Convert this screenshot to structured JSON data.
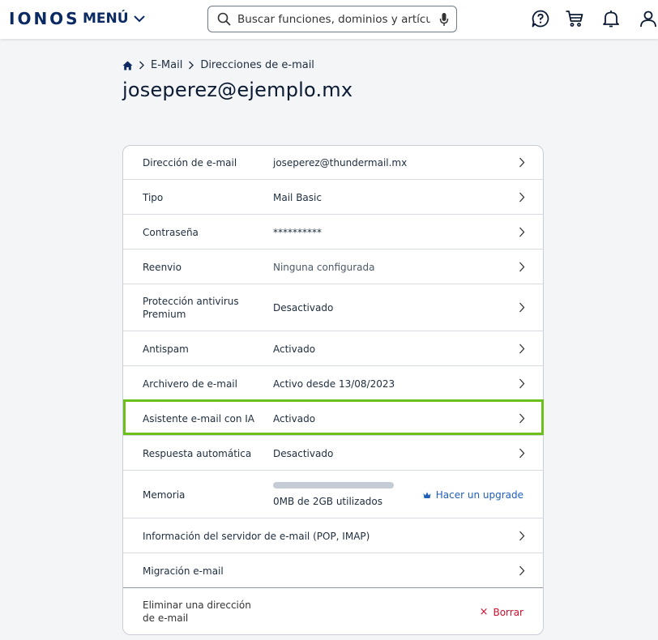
{
  "header": {
    "logo": "IONOS",
    "menu_label": "MENÚ",
    "search_placeholder": "Buscar funciones, dominios y artículos ..."
  },
  "breadcrumb": {
    "items": [
      "E-Mail",
      "Direcciones de e-mail"
    ]
  },
  "page_title": "joseperez@ejemplo.mx",
  "rows": [
    {
      "label": "Dirección de e-mail",
      "value": "joseperez@thundermail.mx"
    },
    {
      "label": "Tipo",
      "value": "Mail Basic"
    },
    {
      "label": "Contraseña",
      "value": "**********"
    },
    {
      "label": "Reenvio",
      "value": "Ninguna configurada"
    },
    {
      "label": "Protección antivirus Premium",
      "value": "Desactivado"
    },
    {
      "label": "Antispam",
      "value": "Activado"
    },
    {
      "label": "Archivero de e-mail",
      "value": "Activo desde 13/08/2023"
    },
    {
      "label": "Asistente e-mail con IA",
      "value": "Activado"
    },
    {
      "label": "Respuesta automática",
      "value": "Desactivado"
    }
  ],
  "memory": {
    "label": "Memoria",
    "usage_text": "0MB de 2GB utilizados",
    "used_fraction": 0,
    "upgrade_label": "Hacer un upgrade"
  },
  "server_info": {
    "label": "Información del servidor de e-mail (POP, IMAP)"
  },
  "migration": {
    "label": "Migración e-mail"
  },
  "delete": {
    "label": "Eliminar una dirección de e-mail",
    "action_label": "Borrar"
  },
  "colors": {
    "brand": "#0b2a63",
    "highlight": "#6bc11a",
    "link": "#1f5fb8",
    "danger": "#c8102e"
  }
}
